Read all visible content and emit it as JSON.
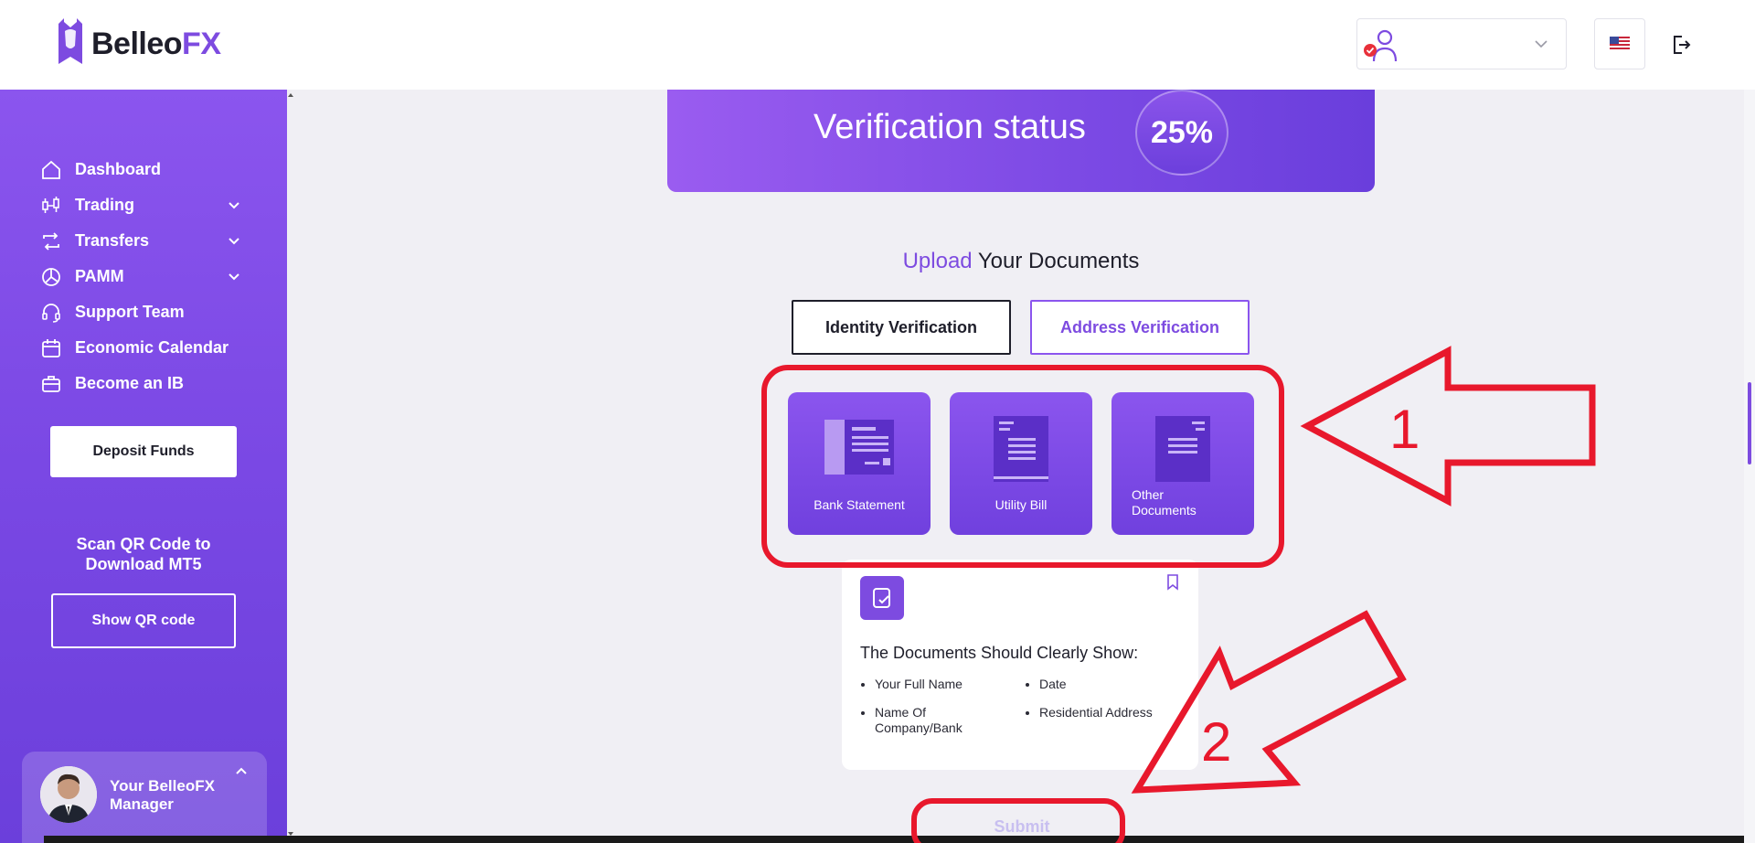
{
  "header": {
    "brand_main": "Belleo",
    "brand_accent": "FX"
  },
  "sidebar": {
    "items": [
      {
        "label": "Dashboard",
        "icon": "home-icon",
        "has_chevron": false
      },
      {
        "label": "Trading",
        "icon": "candlestick-icon",
        "has_chevron": true
      },
      {
        "label": "Transfers",
        "icon": "transfer-icon",
        "has_chevron": true
      },
      {
        "label": "PAMM",
        "icon": "pie-chart-icon",
        "has_chevron": true
      },
      {
        "label": "Support Team",
        "icon": "headset-icon",
        "has_chevron": false
      },
      {
        "label": "Economic Calendar",
        "icon": "calendar-icon",
        "has_chevron": false
      },
      {
        "label": "Become an IB",
        "icon": "briefcase-icon",
        "has_chevron": false
      }
    ],
    "deposit_label": "Deposit Funds",
    "scan_text": "Scan QR Code to Download MT5",
    "qr_label": "Show QR code",
    "manager_label": "Your BelleoFX Manager"
  },
  "main": {
    "status_title": "Verification status",
    "status_percent": "25%",
    "upload_accent": "Upload",
    "upload_rest": " Your Documents",
    "tabs": [
      {
        "label": "Identity Verification",
        "active": true
      },
      {
        "label": "Address Verification",
        "active": false
      }
    ],
    "doc_types": [
      {
        "label": "Bank Statement"
      },
      {
        "label": "Utility Bill"
      },
      {
        "label": "Other Documents"
      }
    ],
    "info_title": "The Documents Should Clearly Show:",
    "requirements_left": [
      "Your Full Name",
      "Name Of Company/Bank"
    ],
    "requirements_right": [
      "Date",
      "Residential Address"
    ],
    "submit_label": "Submit"
  },
  "annotations": {
    "arrow1_label": "1",
    "arrow2_label": "2",
    "color": "#e8182c"
  },
  "colors": {
    "brand": "#7d4be0",
    "sidebar_top": "#8b55ee",
    "sidebar_bottom": "#6b3fdb"
  }
}
